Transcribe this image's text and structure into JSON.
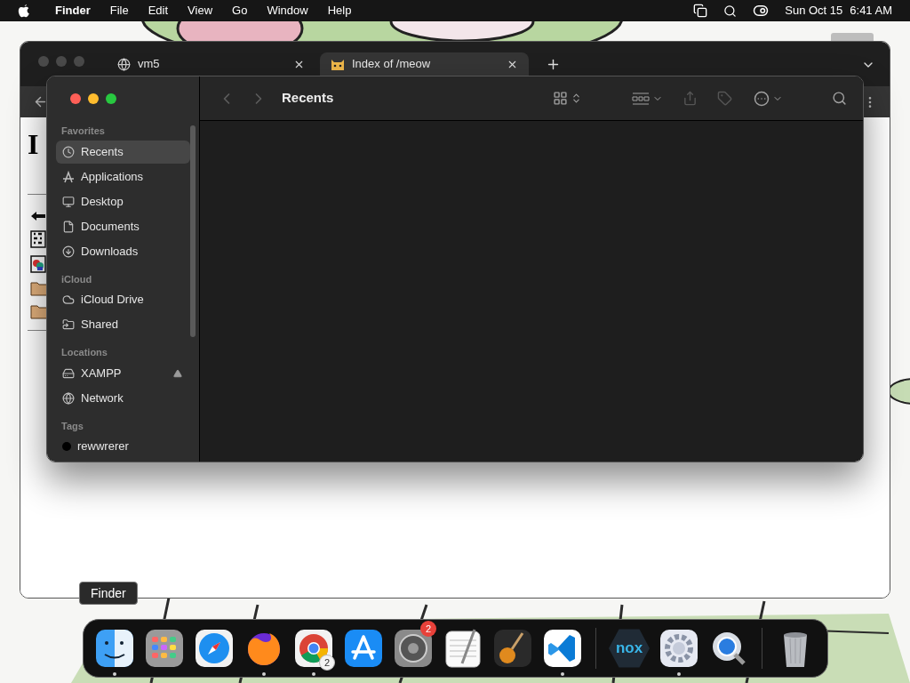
{
  "menu_bar": {
    "app": "Finder",
    "menus": [
      "File",
      "Edit",
      "View",
      "Go",
      "Window",
      "Help"
    ],
    "date": "Sun Oct 15",
    "time": "6:41 AM"
  },
  "browser": {
    "tabs": [
      {
        "title": "vm5",
        "selected": false
      },
      {
        "title": "Index of /meow",
        "selected": true
      }
    ],
    "page": {
      "heading": "I"
    }
  },
  "finder": {
    "title": "Recents",
    "sidebar": [
      {
        "heading": "Favorites",
        "items": [
          {
            "label": "Recents",
            "selected": true
          },
          {
            "label": "Applications",
            "selected": false
          },
          {
            "label": "Desktop",
            "selected": false
          },
          {
            "label": "Documents",
            "selected": false
          },
          {
            "label": "Downloads",
            "selected": false
          }
        ]
      },
      {
        "heading": "iCloud",
        "items": [
          {
            "label": "iCloud Drive",
            "selected": false
          },
          {
            "label": "Shared",
            "selected": false
          }
        ]
      },
      {
        "heading": "Locations",
        "items": [
          {
            "label": "XAMPP",
            "selected": false,
            "eject": true
          },
          {
            "label": "Network",
            "selected": false,
            "eject": false
          }
        ]
      },
      {
        "heading": "Tags",
        "items": [
          {
            "label": "rewwrerer",
            "selected": false,
            "color": "#000000"
          }
        ]
      }
    ]
  },
  "tooltip": "Finder",
  "dock": {
    "sections": [
      {
        "items": [
          {
            "running": true
          },
          {
            "running": false
          },
          {
            "running": false
          },
          {
            "running": true
          },
          {
            "running": true,
            "badge": {
              "text": "2",
              "kind": "grey"
            }
          },
          {
            "running": false
          },
          {
            "running": false,
            "badge": {
              "text": "2",
              "kind": "red"
            }
          },
          {
            "running": false
          },
          {
            "running": false
          },
          {
            "running": true
          }
        ]
      },
      {
        "items": [
          {
            "running": false,
            "logo_text": "nox"
          },
          {
            "running": true
          },
          {
            "running": false
          }
        ]
      },
      {
        "items": [
          {
            "running": false
          }
        ]
      }
    ]
  }
}
